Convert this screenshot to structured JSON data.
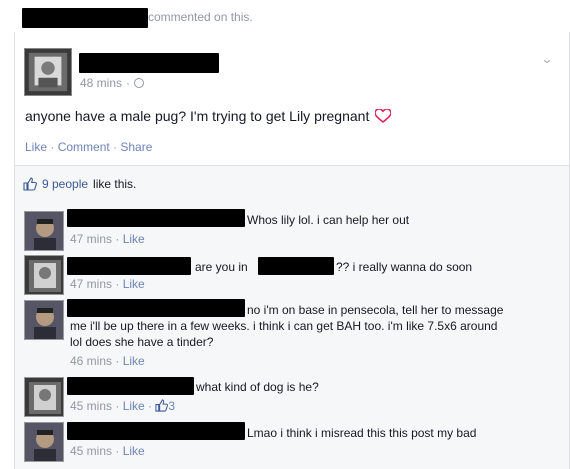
{
  "notification": {
    "commented_on_this": "commented on this."
  },
  "post": {
    "time": "48 mins",
    "time_separator": "·",
    "text": "anyone have a male pug? I'm trying to get Lily pregnant",
    "actions": {
      "like": "Like",
      "sep1": " · ",
      "comment": "Comment",
      "sep2": " · ",
      "share": "Share"
    }
  },
  "likes": {
    "count_link": "9 people",
    "suffix": "like this."
  },
  "comments": [
    {
      "text": "Whos lily lol. i can help her out",
      "time": "47 mins",
      "like": "Like"
    },
    {
      "text_before": "are you in",
      "text_after": "?? i really wanna do soon",
      "time": "47 mins",
      "like": "Like"
    },
    {
      "lines": [
        "no i'm on base in pensecola, tell her to message",
        "me i'll be up there in a few weeks. i think i can get BAH too. i'm like 7.5x6 around",
        "lol does she have a tinder?"
      ],
      "time": "46 mins",
      "like": "Like"
    },
    {
      "text": "what kind of dog is he?",
      "time": "45 mins",
      "like": "Like",
      "like_count": "3"
    },
    {
      "text": "Lmao i think i misread this this post my bad",
      "time": "45 mins",
      "like": "Like"
    }
  ],
  "separator": " · ",
  "icons": {
    "chevron": "chevron-down-icon",
    "globe": "globe-icon",
    "heart": "heart-emoji-icon",
    "thumb": "thumbs-up-icon"
  },
  "colors": {
    "link": "#3b5998",
    "muted": "#9197a3",
    "heart": "#e0245e"
  }
}
